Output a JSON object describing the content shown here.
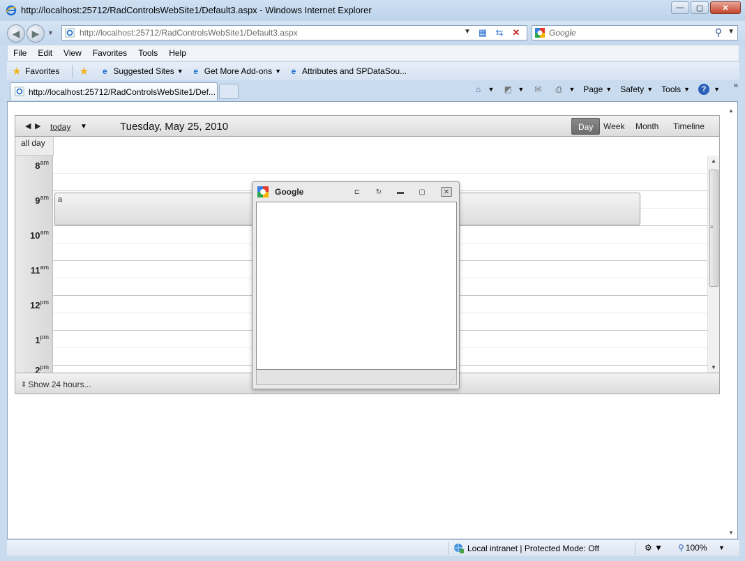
{
  "window": {
    "title": "http://localhost:25712/RadControlsWebSite1/Default3.aspx - Windows Internet Explorer",
    "min": "—",
    "max": "▢",
    "close": "✕"
  },
  "address": {
    "url": "http://localhost:25712/RadControlsWebSite1/Default3.aspx"
  },
  "search": {
    "placeholder": "Google"
  },
  "menu": [
    "File",
    "Edit",
    "View",
    "Favorites",
    "Tools",
    "Help"
  ],
  "favorites_bar": {
    "favorites": "Favorites",
    "suggested": "Suggested Sites",
    "addons": "Get More Add-ons",
    "attributes": "Attributes and SPDataSou..."
  },
  "tab": {
    "title": "http://localhost:25712/RadControlsWebSite1/Def..."
  },
  "command_bar": {
    "page": "Page",
    "safety": "Safety",
    "tools": "Tools"
  },
  "scheduler": {
    "today": "today",
    "date": "Tuesday, May 25, 2010",
    "views": [
      "Day",
      "Week",
      "Month",
      "Timeline"
    ],
    "active_view": "Day",
    "allday_label": "all day",
    "hours": [
      {
        "h": "8",
        "ampm": "am"
      },
      {
        "h": "9",
        "ampm": "am"
      },
      {
        "h": "10",
        "ampm": "am"
      },
      {
        "h": "11",
        "ampm": "am"
      },
      {
        "h": "12",
        "ampm": "pm"
      },
      {
        "h": "1",
        "ampm": "pm"
      },
      {
        "h": "2",
        "ampm": "pm"
      }
    ],
    "appointment": "a",
    "show24": "Show 24 hours..."
  },
  "popup": {
    "title": "Google"
  },
  "status": {
    "zone": "Local intranet | Protected Mode: Off",
    "zoom": "100%"
  },
  "colors": {
    "chrome": "#c9dbee",
    "scheduler_header": "#dcdcdc",
    "active_view": "#6b6b6b"
  }
}
